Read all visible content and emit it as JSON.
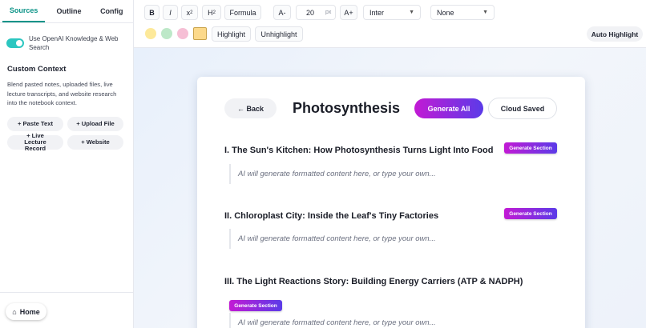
{
  "sidebar": {
    "tabs": [
      {
        "label": "Sources",
        "active": true
      },
      {
        "label": "Outline",
        "active": false
      },
      {
        "label": "Config",
        "active": false
      }
    ],
    "web_search_label": "Use OpenAI Knowledge & Web Search",
    "web_search_enabled": true,
    "custom_context_title": "Custom Context",
    "custom_context_desc": "Blend pasted notes, uploaded files, live lecture transcripts, and website research into the notebook context.",
    "buttons": {
      "paste_text": "+ Paste Text",
      "upload_file": "+ Upload File",
      "live_lecture": "+ Live Lecture Record",
      "website": "+ Website"
    },
    "home_label": "Home",
    "home_icon": "⌂"
  },
  "toolbar": {
    "bold": "B",
    "italic": "I",
    "superscript": "x",
    "superscript_mark": "2",
    "subscript": "H",
    "subscript_mark": "2",
    "formula": "Formula",
    "font_decrease": "A-",
    "font_size": "20",
    "font_unit": "px",
    "font_increase": "A+",
    "font_family": "Inter",
    "style_select": "None",
    "swatches": [
      "#fde99a",
      "#bde8c8",
      "#f6bfd5",
      "#fcd98a"
    ],
    "highlight": "Highlight",
    "unhighlight": "Unhighlight",
    "auto_highlight": "Auto Highlight"
  },
  "document": {
    "back_label": "← Back",
    "title": "Photosynthesis",
    "generate_all": "Generate All",
    "cloud_status": "Cloud Saved",
    "generate_section": "Generate Section",
    "placeholder": "AI will generate formatted content here, or type your own...",
    "sections": [
      {
        "title": "I. The Sun's Kitchen: How Photosynthesis Turns Light Into Food"
      },
      {
        "title": "II. Chloroplast City: Inside the Leaf's Tiny Factories"
      },
      {
        "title": "III. The Light Reactions Story: Building Energy Carriers (ATP & NADPH)"
      }
    ]
  },
  "colors": {
    "accent_teal": "#0d9488",
    "gradient_start": "#c21ad4",
    "gradient_end": "#5b3be8"
  }
}
